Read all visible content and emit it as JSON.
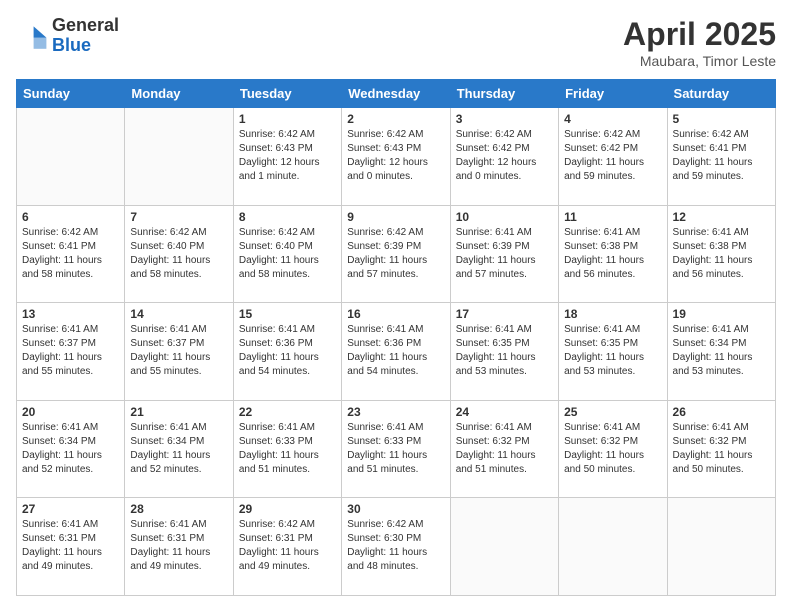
{
  "header": {
    "logo_general": "General",
    "logo_blue": "Blue",
    "title": "April 2025",
    "location": "Maubara, Timor Leste"
  },
  "weekdays": [
    "Sunday",
    "Monday",
    "Tuesday",
    "Wednesday",
    "Thursday",
    "Friday",
    "Saturday"
  ],
  "weeks": [
    [
      {
        "day": "",
        "info": ""
      },
      {
        "day": "",
        "info": ""
      },
      {
        "day": "1",
        "info": "Sunrise: 6:42 AM\nSunset: 6:43 PM\nDaylight: 12 hours\nand 1 minute."
      },
      {
        "day": "2",
        "info": "Sunrise: 6:42 AM\nSunset: 6:43 PM\nDaylight: 12 hours\nand 0 minutes."
      },
      {
        "day": "3",
        "info": "Sunrise: 6:42 AM\nSunset: 6:42 PM\nDaylight: 12 hours\nand 0 minutes."
      },
      {
        "day": "4",
        "info": "Sunrise: 6:42 AM\nSunset: 6:42 PM\nDaylight: 11 hours\nand 59 minutes."
      },
      {
        "day": "5",
        "info": "Sunrise: 6:42 AM\nSunset: 6:41 PM\nDaylight: 11 hours\nand 59 minutes."
      }
    ],
    [
      {
        "day": "6",
        "info": "Sunrise: 6:42 AM\nSunset: 6:41 PM\nDaylight: 11 hours\nand 58 minutes."
      },
      {
        "day": "7",
        "info": "Sunrise: 6:42 AM\nSunset: 6:40 PM\nDaylight: 11 hours\nand 58 minutes."
      },
      {
        "day": "8",
        "info": "Sunrise: 6:42 AM\nSunset: 6:40 PM\nDaylight: 11 hours\nand 58 minutes."
      },
      {
        "day": "9",
        "info": "Sunrise: 6:42 AM\nSunset: 6:39 PM\nDaylight: 11 hours\nand 57 minutes."
      },
      {
        "day": "10",
        "info": "Sunrise: 6:41 AM\nSunset: 6:39 PM\nDaylight: 11 hours\nand 57 minutes."
      },
      {
        "day": "11",
        "info": "Sunrise: 6:41 AM\nSunset: 6:38 PM\nDaylight: 11 hours\nand 56 minutes."
      },
      {
        "day": "12",
        "info": "Sunrise: 6:41 AM\nSunset: 6:38 PM\nDaylight: 11 hours\nand 56 minutes."
      }
    ],
    [
      {
        "day": "13",
        "info": "Sunrise: 6:41 AM\nSunset: 6:37 PM\nDaylight: 11 hours\nand 55 minutes."
      },
      {
        "day": "14",
        "info": "Sunrise: 6:41 AM\nSunset: 6:37 PM\nDaylight: 11 hours\nand 55 minutes."
      },
      {
        "day": "15",
        "info": "Sunrise: 6:41 AM\nSunset: 6:36 PM\nDaylight: 11 hours\nand 54 minutes."
      },
      {
        "day": "16",
        "info": "Sunrise: 6:41 AM\nSunset: 6:36 PM\nDaylight: 11 hours\nand 54 minutes."
      },
      {
        "day": "17",
        "info": "Sunrise: 6:41 AM\nSunset: 6:35 PM\nDaylight: 11 hours\nand 53 minutes."
      },
      {
        "day": "18",
        "info": "Sunrise: 6:41 AM\nSunset: 6:35 PM\nDaylight: 11 hours\nand 53 minutes."
      },
      {
        "day": "19",
        "info": "Sunrise: 6:41 AM\nSunset: 6:34 PM\nDaylight: 11 hours\nand 53 minutes."
      }
    ],
    [
      {
        "day": "20",
        "info": "Sunrise: 6:41 AM\nSunset: 6:34 PM\nDaylight: 11 hours\nand 52 minutes."
      },
      {
        "day": "21",
        "info": "Sunrise: 6:41 AM\nSunset: 6:34 PM\nDaylight: 11 hours\nand 52 minutes."
      },
      {
        "day": "22",
        "info": "Sunrise: 6:41 AM\nSunset: 6:33 PM\nDaylight: 11 hours\nand 51 minutes."
      },
      {
        "day": "23",
        "info": "Sunrise: 6:41 AM\nSunset: 6:33 PM\nDaylight: 11 hours\nand 51 minutes."
      },
      {
        "day": "24",
        "info": "Sunrise: 6:41 AM\nSunset: 6:32 PM\nDaylight: 11 hours\nand 51 minutes."
      },
      {
        "day": "25",
        "info": "Sunrise: 6:41 AM\nSunset: 6:32 PM\nDaylight: 11 hours\nand 50 minutes."
      },
      {
        "day": "26",
        "info": "Sunrise: 6:41 AM\nSunset: 6:32 PM\nDaylight: 11 hours\nand 50 minutes."
      }
    ],
    [
      {
        "day": "27",
        "info": "Sunrise: 6:41 AM\nSunset: 6:31 PM\nDaylight: 11 hours\nand 49 minutes."
      },
      {
        "day": "28",
        "info": "Sunrise: 6:41 AM\nSunset: 6:31 PM\nDaylight: 11 hours\nand 49 minutes."
      },
      {
        "day": "29",
        "info": "Sunrise: 6:42 AM\nSunset: 6:31 PM\nDaylight: 11 hours\nand 49 minutes."
      },
      {
        "day": "30",
        "info": "Sunrise: 6:42 AM\nSunset: 6:30 PM\nDaylight: 11 hours\nand 48 minutes."
      },
      {
        "day": "",
        "info": ""
      },
      {
        "day": "",
        "info": ""
      },
      {
        "day": "",
        "info": ""
      }
    ]
  ]
}
